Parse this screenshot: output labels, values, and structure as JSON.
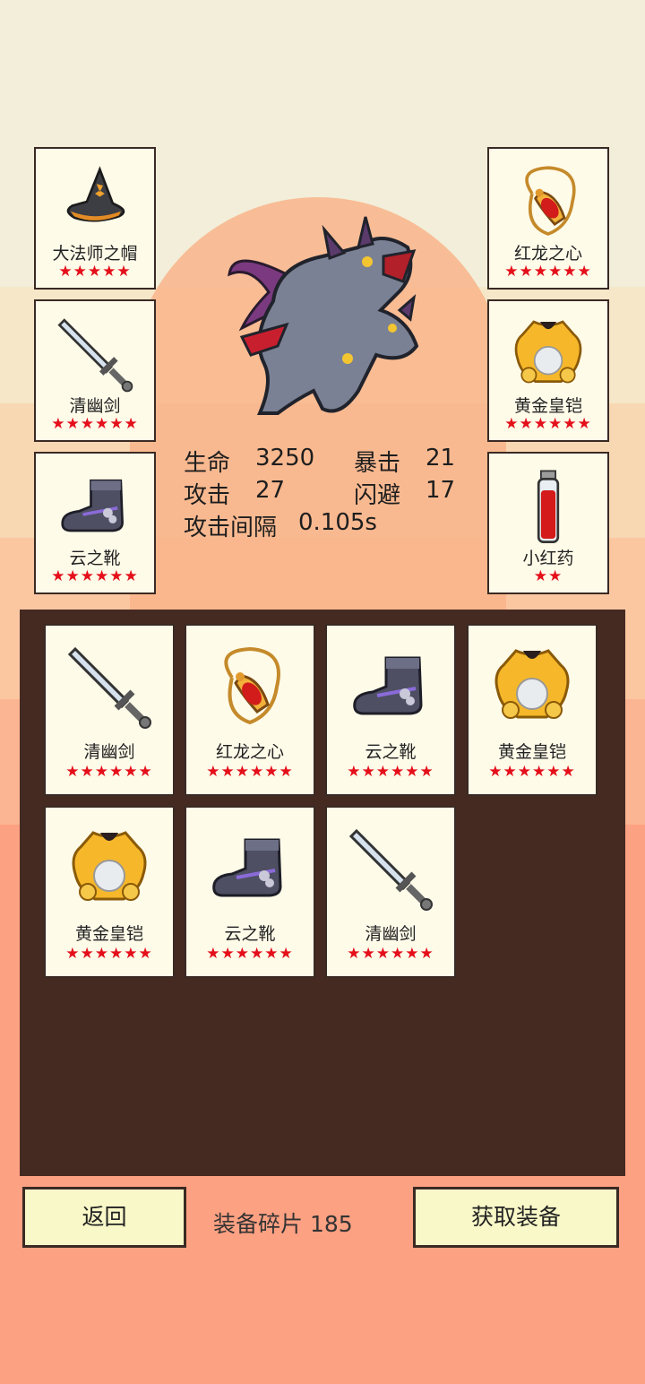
{
  "equipped_left": [
    {
      "name": "大法师之帽",
      "stars": "★★★★★",
      "icon": "wizard-hat-icon"
    },
    {
      "name": "清幽剑",
      "stars": "★★★★★★",
      "icon": "sword-icon"
    },
    {
      "name": "云之靴",
      "stars": "★★★★★★",
      "icon": "boot-icon"
    }
  ],
  "equipped_right": [
    {
      "name": "红龙之心",
      "stars": "★★★★★★",
      "icon": "amulet-icon"
    },
    {
      "name": "黄金皇铠",
      "stars": "★★★★★★",
      "icon": "gold-armor-icon"
    },
    {
      "name": "小红药",
      "stars": "★★",
      "icon": "red-potion-icon"
    }
  ],
  "stats": {
    "hp_label": "生命",
    "hp_value": "3250",
    "crit_label": "暴击",
    "crit_value": "21",
    "atk_label": "攻击",
    "atk_value": "27",
    "dodge_label": "闪避",
    "dodge_value": "17",
    "interval_label": "攻击间隔",
    "interval_value": "0.105s"
  },
  "inventory": [
    {
      "name": "清幽剑",
      "stars": "★★★★★★",
      "icon": "sword-icon"
    },
    {
      "name": "红龙之心",
      "stars": "★★★★★★",
      "icon": "amulet-icon"
    },
    {
      "name": "云之靴",
      "stars": "★★★★★★",
      "icon": "boot-icon"
    },
    {
      "name": "黄金皇铠",
      "stars": "★★★★★★",
      "icon": "gold-armor-icon"
    },
    {
      "name": "黄金皇铠",
      "stars": "★★★★★★",
      "icon": "gold-armor-icon"
    },
    {
      "name": "云之靴",
      "stars": "★★★★★★",
      "icon": "boot-icon"
    },
    {
      "name": "清幽剑",
      "stars": "★★★★★★",
      "icon": "sword-icon"
    }
  ],
  "footer": {
    "back_label": "返回",
    "shards_label": "装备碎片",
    "shards_value": "185",
    "get_label": "获取装备"
  },
  "colors": {
    "star": "#e40f1a",
    "panel": "#452a22",
    "button": "#f8f8c8",
    "card": "#fffbe9"
  }
}
